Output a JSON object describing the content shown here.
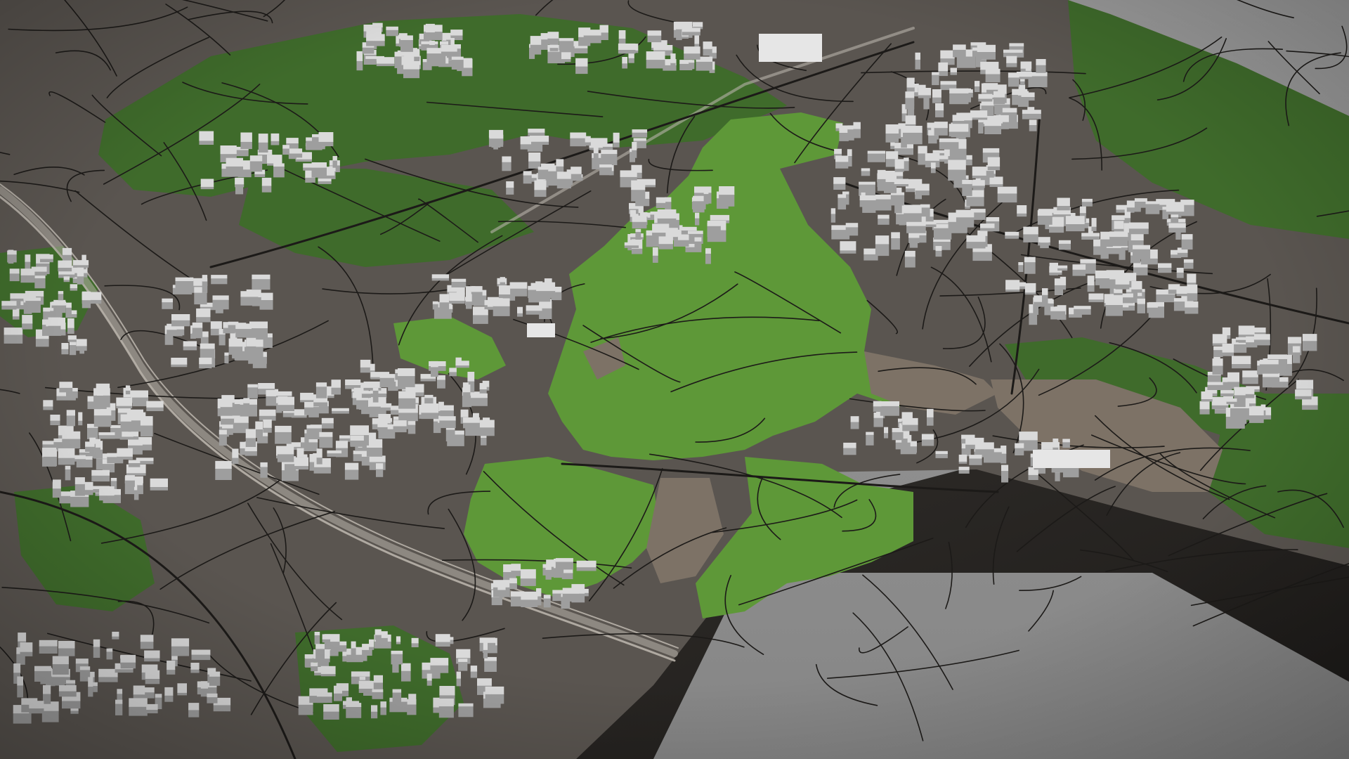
{
  "scene": {
    "kind": "3d-city-terrain-model",
    "view": "oblique-aerial",
    "colors": {
      "background": "#8f8f8f",
      "terrain_urban": "#5a5550",
      "terrain_bare": "#7e7368",
      "park_dark": "#3e6a2a",
      "park_light": "#5f9a3a",
      "roads": "#1c1a18",
      "buildings": "#d9d9d9",
      "buildings_shade": "#9e9e9e",
      "block_side": "#262422",
      "railway": "#b8b2aa"
    }
  }
}
